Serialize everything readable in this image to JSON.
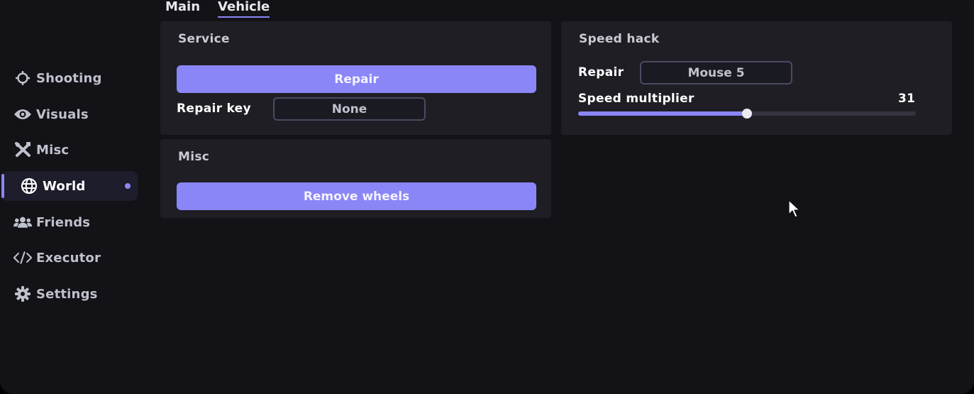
{
  "colors": {
    "accent": "#8b86f8",
    "background": "#121217",
    "panel": "#1e1e24",
    "text": "#ffffff",
    "muted_text": "#bfc1cc"
  },
  "sidebar": {
    "items": [
      {
        "label": "Shooting",
        "icon": "crosshair-icon"
      },
      {
        "label": "Visuals",
        "icon": "eye-icon"
      },
      {
        "label": "Misc",
        "icon": "tools-icon"
      },
      {
        "label": "World",
        "icon": "globe-icon",
        "active": true
      },
      {
        "label": "Friends",
        "icon": "users-icon"
      },
      {
        "label": "Executor",
        "icon": "code-icon"
      },
      {
        "label": "Settings",
        "icon": "gear-icon"
      }
    ]
  },
  "tabs": [
    {
      "label": "Main",
      "active": false
    },
    {
      "label": "Vehicle",
      "active": true
    }
  ],
  "service": {
    "title": "Service",
    "repair_button": "Repair",
    "repair_key_label": "Repair key",
    "repair_key_value": "None"
  },
  "misc": {
    "title": "Misc",
    "remove_wheels_button": "Remove wheels"
  },
  "speed_hack": {
    "title": "Speed hack",
    "repair_label": "Repair",
    "repair_key_value": "Mouse 5",
    "multiplier_label": "Speed multiplier",
    "multiplier_value": "31",
    "multiplier_fraction": 0.5
  }
}
